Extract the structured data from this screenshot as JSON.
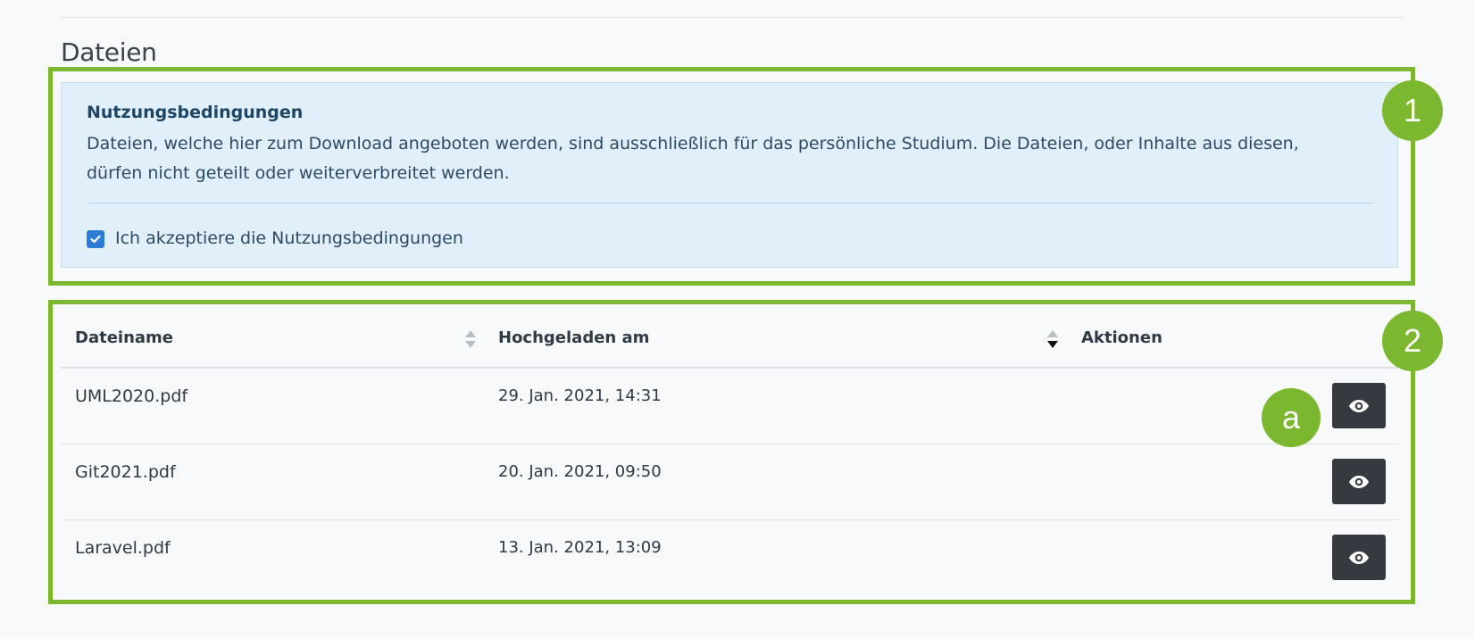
{
  "section": {
    "title": "Dateien"
  },
  "terms": {
    "title": "Nutzungsbedingungen",
    "text": "Dateien, welche hier zum Download angeboten werden, sind ausschließlich für das persönliche Studium. Die Dateien, oder Inhalte aus diesen, dürfen nicht geteilt oder weiterverbreitet werden.",
    "checkbox_label": "Ich akzeptiere die Nutzungsbedingungen",
    "checkbox_checked": true
  },
  "table": {
    "columns": {
      "name": "Dateiname",
      "uploaded": "Hochgeladen am",
      "actions": "Aktionen"
    },
    "rows": [
      {
        "name": "UML2020.pdf",
        "uploaded": "29. Jan. 2021, 14:31",
        "action_icon": "eye-icon"
      },
      {
        "name": "Git2021.pdf",
        "uploaded": "20. Jan. 2021, 09:50",
        "action_icon": "eye-icon"
      },
      {
        "name": "Laravel.pdf",
        "uploaded": "13. Jan. 2021, 13:09",
        "action_icon": "eye-icon"
      }
    ]
  },
  "callouts": {
    "one": "1",
    "two": "2",
    "a": "a"
  },
  "colors": {
    "callout_green": "#7cb82f",
    "info_background": "#e1effa",
    "checkbox_blue": "#2c7cd5",
    "button_dark": "#343a40"
  }
}
